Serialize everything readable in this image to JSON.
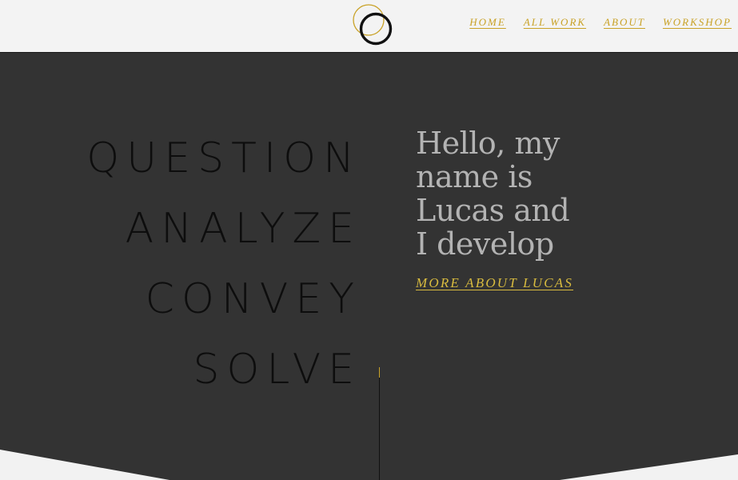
{
  "nav": {
    "items": [
      {
        "label": "HOME"
      },
      {
        "label": "ALL WORK"
      },
      {
        "label": "ABOUT"
      },
      {
        "label": "WORKSHOP"
      }
    ]
  },
  "logo": {
    "icon": "double-ring-logo-icon",
    "ring_colors": [
      "#c9a227",
      "#111111"
    ]
  },
  "hero": {
    "values": [
      "QUESTION",
      "ANALYZE",
      "CONVEY",
      "SOLVE"
    ],
    "intro_lines": [
      "Hello, my",
      "name is",
      "Lucas and",
      "I develop"
    ],
    "more_link": "MORE ABOUT LUCAS"
  },
  "colors": {
    "accent": "#c9a227",
    "hero_bg": "#333333",
    "header_bg": "#f3f3f3",
    "intro_text": "#b3b3b3"
  }
}
